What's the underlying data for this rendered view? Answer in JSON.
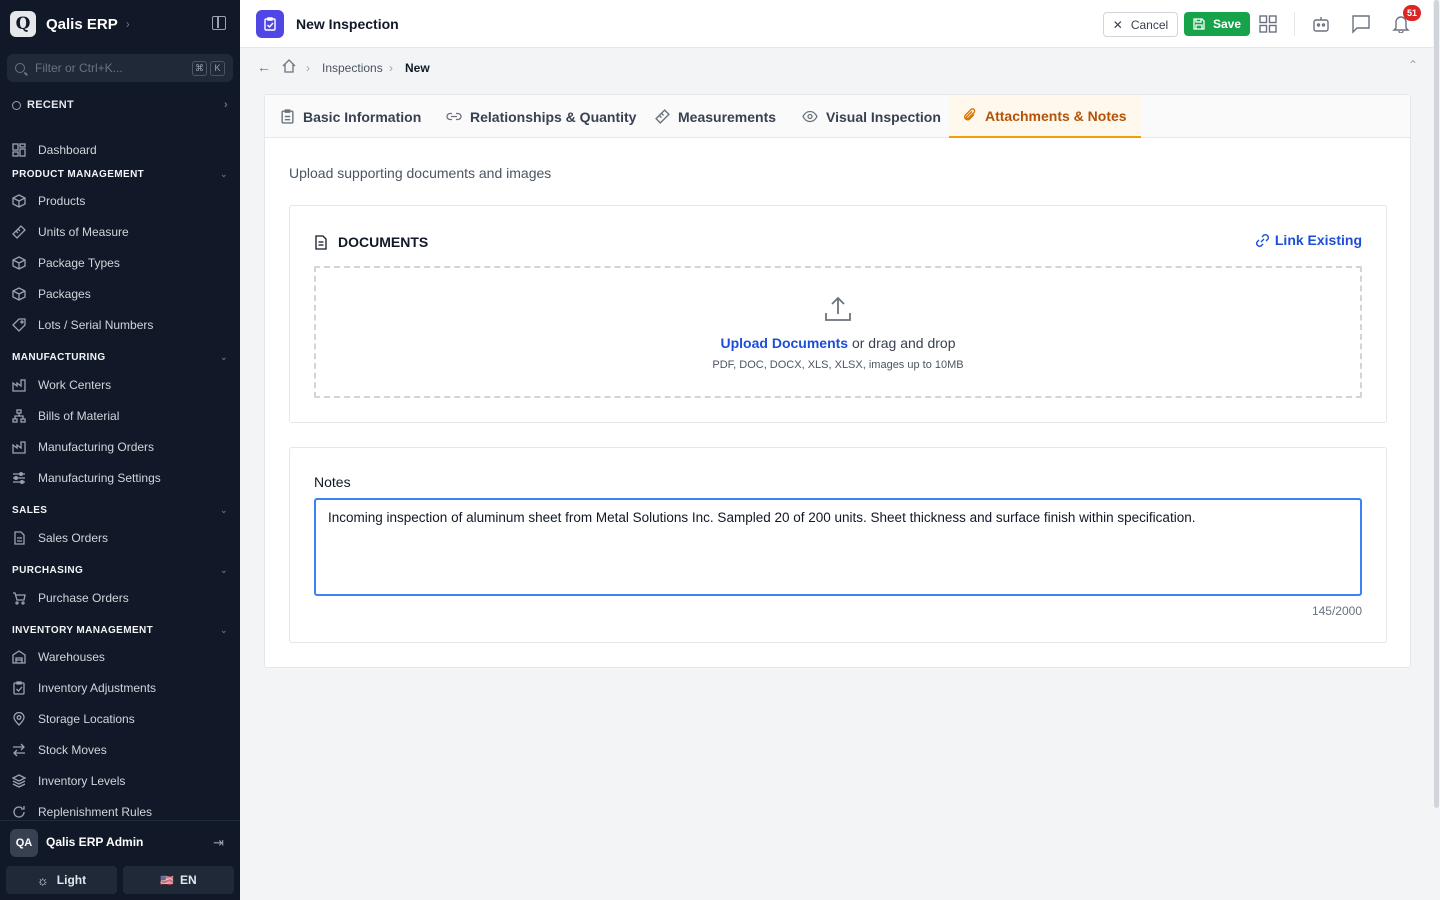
{
  "app": {
    "name": "Qalis ERP",
    "logo_letter": "Q"
  },
  "sidebar": {
    "filter_placeholder": "Filter or Ctrl+K...",
    "kbd": [
      "⌘",
      "K"
    ],
    "recent_label": "RECENT",
    "dashboard": "Dashboard",
    "sections": [
      {
        "title": "PRODUCT MANAGEMENT",
        "items": [
          "Products",
          "Units of Measure",
          "Package Types",
          "Packages",
          "Lots / Serial Numbers"
        ]
      },
      {
        "title": "MANUFACTURING",
        "items": [
          "Work Centers",
          "Bills of Material",
          "Manufacturing Orders",
          "Manufacturing Settings"
        ]
      },
      {
        "title": "SALES",
        "items": [
          "Sales Orders"
        ]
      },
      {
        "title": "PURCHASING",
        "items": [
          "Purchase Orders"
        ]
      },
      {
        "title": "INVENTORY MANAGEMENT",
        "items": [
          "Warehouses",
          "Inventory Adjustments",
          "Storage Locations",
          "Stock Moves",
          "Inventory Levels",
          "Replenishment Rules"
        ]
      }
    ],
    "user": {
      "initials": "QA",
      "name": "Qalis ERP Admin"
    },
    "theme_label": "Light",
    "lang_label": "EN",
    "lang_flag": "🇺🇸"
  },
  "header": {
    "title": "New Inspection",
    "cancel_label": "Cancel",
    "save_label": "Save",
    "notification_count": "51"
  },
  "breadcrumb": {
    "items": [
      "Inspections",
      "New"
    ]
  },
  "tabs": [
    {
      "label": "Basic Information",
      "icon": "clipboard-icon"
    },
    {
      "label": "Relationships & Quantity",
      "icon": "link-icon"
    },
    {
      "label": "Measurements",
      "icon": "ruler-icon"
    },
    {
      "label": "Visual Inspection",
      "icon": "eye-icon"
    },
    {
      "label": "Attachments & Notes",
      "icon": "paperclip-icon",
      "active": true
    }
  ],
  "content": {
    "subtitle": "Upload supporting documents and images",
    "documents": {
      "title": "DOCUMENTS",
      "link_existing": "Link Existing",
      "upload_link": "Upload Documents",
      "upload_rest": " or drag and drop",
      "hint": "PDF, DOC, DOCX, XLS, XLSX, images up to 10MB"
    },
    "notes": {
      "label": "Notes",
      "value": "Incoming inspection of aluminum sheet from Metal Solutions Inc. Sampled 20 of 200 units. Sheet thickness and surface finish within specification.",
      "counter": "145/2000"
    }
  },
  "colors": {
    "sidebar_bg": "#111827",
    "accent": "#4f46e5",
    "save": "#16a34a",
    "active_tab": "#b45309",
    "link": "#1d4ed8",
    "badge": "#dc2626"
  }
}
